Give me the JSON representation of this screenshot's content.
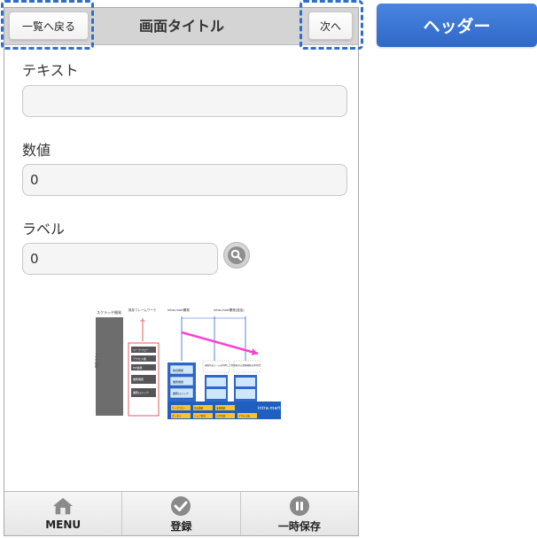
{
  "header": {
    "back_label": "一覧へ戻る",
    "title": "画面タイトル",
    "next_label": "次へ"
  },
  "side_badge": "ヘッダー",
  "form": {
    "text": {
      "label": "テキスト",
      "value": ""
    },
    "number": {
      "label": "数値",
      "value": "0"
    },
    "label_field": {
      "label": "ラベル",
      "value": "0"
    }
  },
  "diagram": {
    "left_title": "スクラッチ開発",
    "framework_title": "既存フレームワーク",
    "mid_title": "intra-mart開発",
    "right_title": "intra-mart開発(追加)",
    "vertical_cost": "開発コスト",
    "framework_items": [
      "ワークフロー",
      "アクセス権",
      "EIP連携",
      "業務機能",
      "業務ロジック"
    ],
    "blue_items": [
      "独自機能",
      "業務機能",
      "業務ロジック"
    ],
    "brand": "intra-mart",
    "base_row1": [
      "ワークフロー",
      "独自機能",
      "業務機能"
    ],
    "base_row2": [
      "ポータル",
      "ジョブ管理",
      "ログ管理",
      "アクセス権"
    ],
    "note1": "画面作成ツールを利用して開発",
    "note2": "既存の業務機能を再利用"
  },
  "footer": {
    "tabs": [
      {
        "label": "MENU",
        "icon": "home-icon"
      },
      {
        "label": "登録",
        "icon": "check-icon"
      },
      {
        "label": "一時保存",
        "icon": "pause-icon"
      }
    ]
  },
  "colors": {
    "accent_blue": "#2f68c8",
    "dash_blue": "#2d6fd1",
    "magenta_arrow": "#ff3fd6"
  }
}
